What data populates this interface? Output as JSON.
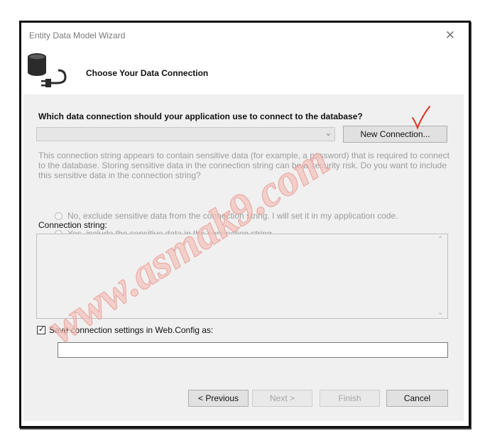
{
  "window": {
    "title": "Entity Data Model Wizard",
    "close_glyph": "✕"
  },
  "header": {
    "heading": "Choose Your Data Connection",
    "icon": "database-plug-icon"
  },
  "connection": {
    "question": "Which data connection should your application use to connect to the database?",
    "selected": "",
    "new_connection_label": "New Connection...",
    "warning": "This connection string appears to contain sensitive data (for example, a password) that is required to connect to the database. Storing sensitive data in the connection string can be a security risk. Do you want to include this sensitive data in the connection string?",
    "option_exclude": "No, exclude sensitive data from the connection string. I will set it in my application code.",
    "option_include": "Yes, include the sensitive data in the connection string.",
    "connection_string_label": "Connection string:",
    "connection_string_value": ""
  },
  "save": {
    "label": "Save connection settings in Web.Config as:",
    "checked": true,
    "value": ""
  },
  "footer": {
    "previous": "< Previous",
    "next": "Next >",
    "finish": "Finish",
    "cancel": "Cancel"
  },
  "watermark": {
    "text": "www.asmak9.com"
  },
  "colors": {
    "content_bg": "#f0f0f0",
    "watermark": "#f0a8a2",
    "annotation": "#e03020"
  }
}
